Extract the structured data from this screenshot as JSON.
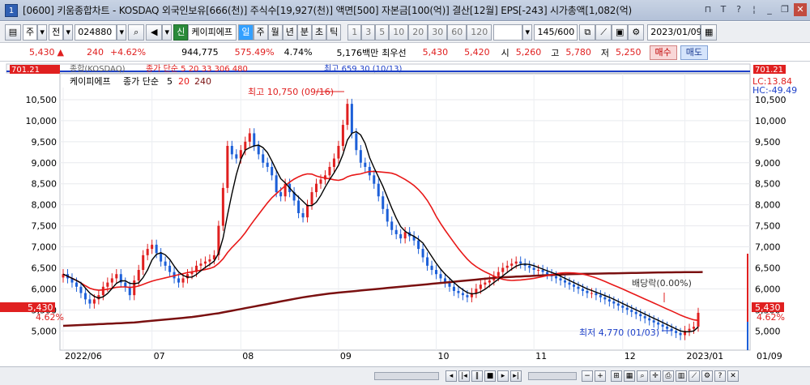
{
  "title": {
    "window_number": "1",
    "text": "[0600] 키움종합차트 - KOSDAQ 외국인보유[666(천)] 주식수[19,927(천)] 액면[500] 자본금[100(억)] 결산[12월] EPS[-243] 시가총액[1,082(억)"
  },
  "toolbar": {
    "period": "주",
    "market": "전",
    "code": "024880",
    "chart_type": "신",
    "stock_name": "케이피에프",
    "intervals": [
      "일",
      "주",
      "월",
      "년",
      "분",
      "초",
      "틱"
    ],
    "active_interval": "일",
    "minute_options": [
      "1",
      "3",
      "5",
      "10",
      "20",
      "30",
      "60",
      "120"
    ],
    "count": "145",
    "count_total": "/600",
    "date": "2023/01/09"
  },
  "pricebar": {
    "current": "5,430",
    "change": "240",
    "change_pct": "+4.62%",
    "volume": "944,775",
    "vol_ratio": "575.49%",
    "turnover": "4.74%",
    "amount": "5,176백만",
    "best_label": "최우선",
    "ask": "5,430",
    "bid": "5,420",
    "open_label": "시",
    "open": "5,260",
    "high_label": "고",
    "high": "5,780",
    "low_label": "저",
    "low": "5,250",
    "buy_label": "매수",
    "sell_label": "매도"
  },
  "chart_data": {
    "type": "candlestick",
    "stock": "케이피에프",
    "legend": [
      "케이피에프",
      "종가 단순",
      "5",
      "20",
      "240"
    ],
    "top_strip": {
      "label": "종합(KOSDAQ)",
      "legend_text": "종가 단순 5  20  33  306  480",
      "value": "701.21",
      "high_note": "최고 659.30 (10/13)"
    },
    "y_ticks": [
      10500,
      10000,
      9500,
      9000,
      8500,
      8000,
      7500,
      7000,
      6500,
      6000,
      5500,
      5000
    ],
    "y_tick_labels": [
      "10,500",
      "10,000",
      "9,500",
      "9,000",
      "8,500",
      "8,000",
      "7,500",
      "7,000",
      "6,500",
      "6,000",
      "5,500",
      "5,000"
    ],
    "ylim": [
      4600,
      11000
    ],
    "x_labels": [
      "2022/06",
      "07",
      "08",
      "09",
      "10",
      "11",
      "12",
      "2023/01"
    ],
    "x_label_right": "01/09",
    "annotations": {
      "high": "최고 10,750 (09/16)",
      "low": "최저 4,770 (01/03)",
      "reverse": "배당락(0.00%)"
    },
    "right_labels": {
      "lc": "LC:13.84",
      "hc": "HC:-49.49",
      "price": "5,430",
      "pct": "4.62%"
    },
    "left_labels": {
      "price": "5,430",
      "pct": "4.62%"
    },
    "close": [
      6350,
      6250,
      6150,
      6050,
      5900,
      5750,
      5650,
      5750,
      5850,
      6050,
      6150,
      6250,
      6350,
      6150,
      6050,
      5850,
      6200,
      6450,
      6800,
      6950,
      7050,
      6850,
      6650,
      6550,
      6400,
      6250,
      6150,
      6250,
      6350,
      6400,
      6550,
      6600,
      6650,
      6700,
      6800,
      7500,
      8400,
      9400,
      9200,
      9100,
      9300,
      9500,
      9700,
      9400,
      9200,
      9000,
      8900,
      8700,
      8300,
      8200,
      8500,
      8300,
      8100,
      7800,
      7700,
      8000,
      8300,
      8500,
      8600,
      8700,
      8900,
      9100,
      9400,
      9900,
      10400,
      9700,
      9300,
      9000,
      8900,
      8700,
      8500,
      8200,
      7900,
      7600,
      7400,
      7300,
      7200,
      7350,
      7250,
      7150,
      6950,
      6750,
      6550,
      6450,
      6350,
      6250,
      6150,
      6050,
      5950,
      5900,
      5850,
      5800,
      5900,
      6000,
      6100,
      6150,
      6200,
      6300,
      6400,
      6500,
      6550,
      6600,
      6650,
      6600,
      6550,
      6500,
      6450,
      6450,
      6400,
      6350,
      6300,
      6250,
      6200,
      6150,
      6100,
      6050,
      6000,
      5950,
      5900,
      5900,
      5850,
      5800,
      5750,
      5700,
      5650,
      5600,
      5550,
      5500,
      5450,
      5400,
      5350,
      5300,
      5250,
      5200,
      5150,
      5100,
      5050,
      5000,
      4950,
      4900,
      5000,
      5050,
      5100,
      5430
    ],
    "ma240": [
      5120,
      5125,
      5130,
      5135,
      5140,
      5145,
      5150,
      5155,
      5160,
      5165,
      5170,
      5175,
      5180,
      5185,
      5190,
      5195,
      5200,
      5210,
      5220,
      5230,
      5240,
      5250,
      5260,
      5270,
      5280,
      5290,
      5300,
      5310,
      5320,
      5330,
      5345,
      5360,
      5375,
      5390,
      5405,
      5420,
      5440,
      5460,
      5480,
      5500,
      5520,
      5540,
      5560,
      5580,
      5600,
      5620,
      5640,
      5660,
      5680,
      5700,
      5720,
      5740,
      5760,
      5780,
      5800,
      5815,
      5830,
      5845,
      5860,
      5875,
      5890,
      5900,
      5910,
      5920,
      5930,
      5940,
      5950,
      5960,
      5970,
      5980,
      5990,
      6000,
      6010,
      6020,
      6030,
      6040,
      6050,
      6060,
      6070,
      6080,
      6090,
      6100,
      6110,
      6120,
      6130,
      6140,
      6150,
      6160,
      6170,
      6180,
      6190,
      6200,
      6210,
      6220,
      6230,
      6240,
      6250,
      6260,
      6270,
      6275,
      6280,
      6285,
      6290,
      6295,
      6300,
      6305,
      6310,
      6315,
      6320,
      6325,
      6330,
      6335,
      6340,
      6345,
      6350,
      6352,
      6354,
      6356,
      6358,
      6360,
      6362,
      6364,
      6366,
      6368,
      6370,
      6372,
      6374,
      6376,
      6378,
      6380,
      6382,
      6384,
      6386,
      6388,
      6390,
      6391,
      6392,
      6393,
      6394,
      6395,
      6396,
      6397,
      6398,
      6399,
      6400
    ]
  },
  "colors": {
    "up": "#e02020",
    "down": "#1c5fd8",
    "ma5": "#000000",
    "ma20": "#e81818",
    "ma240": "#7a1010",
    "price_box": "#e02020"
  },
  "icons": [
    "gear-icon",
    "close-icon",
    "minimize-icon",
    "maximize-icon",
    "restore-icon",
    "pin-icon",
    "calendar-icon",
    "dropdown-icon",
    "search-icon"
  ]
}
